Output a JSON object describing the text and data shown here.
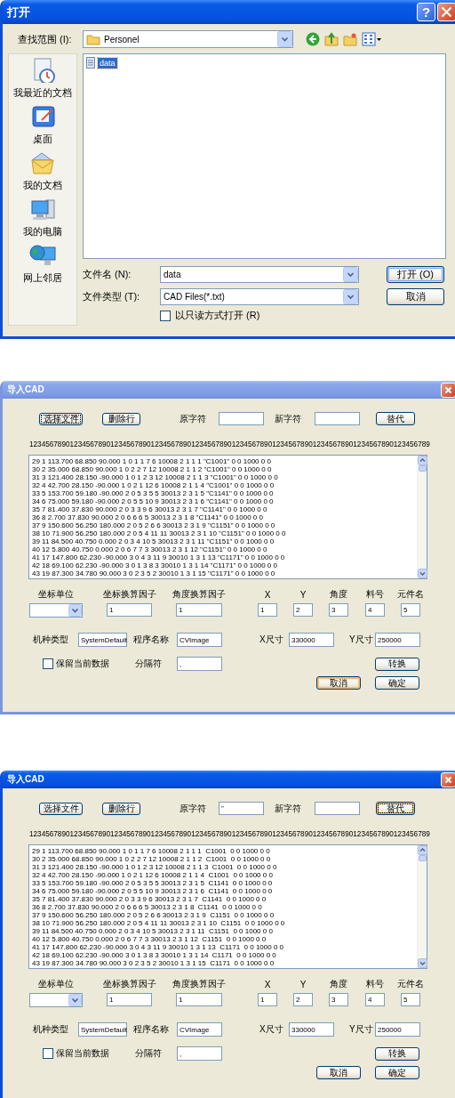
{
  "open_dialog": {
    "window": {
      "title": "打开",
      "active": true
    },
    "help_button": "?",
    "look_in": {
      "label": "查找范围 (I):",
      "value": "Personel"
    },
    "places": [
      {
        "label": "我最近的文档",
        "kind": "recent"
      },
      {
        "label": "桌面",
        "kind": "desktop"
      },
      {
        "label": "我的文档",
        "kind": "documents"
      },
      {
        "label": "我的电脑",
        "kind": "computer"
      },
      {
        "label": "网上邻居",
        "kind": "network"
      }
    ],
    "files": [
      {
        "name": "data",
        "selected": true
      }
    ],
    "file_name": {
      "label": "文件名 (N):",
      "value": "data"
    },
    "file_type": {
      "label": "文件类型 (T):",
      "value": "CAD Files(*.txt)"
    },
    "buttons": [
      {
        "label": "打开 (O)",
        "default": true
      },
      {
        "label": "取消",
        "default": false
      }
    ],
    "read_only": {
      "label": "以只读方式打开 (R)",
      "checked": false
    }
  },
  "import_dialogs": [
    {
      "window": {
        "title": "导入CAD",
        "active": false
      },
      "toolbar_buttons": [
        {
          "label": "选择文件",
          "focused": true,
          "hovered": false
        },
        {
          "label": "删除行",
          "focused": false,
          "hovered": false
        }
      ],
      "find": {
        "label": "原字符"
      },
      "replace_with": {
        "label": "新字符"
      },
      "replace_button": {
        "label": "替代",
        "focused": false,
        "hovered": false
      },
      "ruler": "123456789012345678901234567890123456789012345678901234567890123456789012345678901234567890123456789",
      "lines": [
        "29 1 113.700 68.850 90.000 1 0 1 1 7 6 10008 2 1 1 1 \"C1001\" 0 0 1000 0 0",
        "30 2 35.000 68.850 90.000 1 0 2 2 7 12 10008 2 1 1 2 \"C1001\" 0 0 1000 0 0",
        "31 3 121.400 28.150 -90.000 1 0 1 2 3 12 10008 2 1 1 3 \"C1001\" 0 0 1000 0 0",
        "32 4 42.700 28.150 -90.000 1 0 2 1 12 6 10008 2 1 1 4 \"C1001\" 0 0 1000 0 0",
        "33 5 153.700 59.180 -90.000 2 0 5 3 5 5 30013 2 3 1 5 \"C1141\" 0 0 1000 0 0",
        "34 6 75.000 59.180 -90.000 2 0 5 5 10 9 30013 2 3 1 6 \"C1141\" 0 0 1000 0 0",
        "35 7 81.400 37.830 90.000 2 0 3 3 9 6 30013 2 3 1 7 \"C1141\" 0 0 1000 0 0",
        "36 8 2.700 37.830 90.000 2 0 6 6 6 5 30013 2 3 1 8 \"C1141\" 0 0 1000 0 0",
        "37 9 150.600 56.250 180.000 2 0 5 2 6 6 30013 2 3 1 9 \"C1151\" 0 0 1000 0 0",
        "38 10 71.900 56.250 180.000 2 0 5 4 11 11 30013 2 3 1 10 \"C1151\" 0 0 1000 0 0",
        "39 11 84.500 40.750 0.000 2 0 3 4 10 5 30013 2 3 1 11 \"C1151\" 0 0 1000 0 0",
        "40 12 5.800 40.750 0.000 2 0 6 7 7 3 30013 2 3 1 12 \"C1151\" 0 0 1000 0 0",
        "41 17 147.800 62.230 -90.000 3 0 4 3 11 9 30010 1 3 1 13 \"C1171\" 0 0 1000 0 0",
        "42 18 69.100 62.230 -90.000 3 0 1 3 8 3 30010 1 3 1 14 \"C1171\" 0 0 1000 0 0",
        "43 19 87.300 34.780 90.000 3 0 2 3 5 2 30010 1 3 1 15 \"C1171\" 0 0 1000 0 0"
      ],
      "columns": [
        {
          "label": "坐标单位",
          "kind": "dropdown"
        },
        {
          "label": "坐标换算因子",
          "kind": "field",
          "value": "1"
        },
        {
          "label": "角度换算因子",
          "kind": "field",
          "value": "1"
        },
        {
          "label": "X",
          "kind": "field",
          "value": "1"
        },
        {
          "label": "Y",
          "kind": "field",
          "value": "2"
        },
        {
          "label": "角度",
          "kind": "field",
          "value": "3"
        },
        {
          "label": "料号",
          "kind": "field",
          "value": "4"
        },
        {
          "label": "元件名",
          "kind": "field",
          "value": "5"
        }
      ],
      "settings": [
        {
          "label": "机种类型",
          "value": "SystemDefault"
        },
        {
          "label": "程序名称",
          "value": "CVImage"
        },
        {
          "label": "X尺寸",
          "value": "330000"
        },
        {
          "label": "Y尺寸",
          "value": "250000"
        }
      ],
      "keep_data": {
        "label": "保留当前数据",
        "checked": false
      },
      "separator": {
        "label": "分隔符",
        "value": ","
      },
      "buttons": [
        {
          "label": "转换",
          "focused": false,
          "hovered": false
        },
        {
          "label": "取消",
          "focused": false,
          "hovered": true
        },
        {
          "label": "确定",
          "focused": false,
          "hovered": false
        }
      ]
    },
    {
      "window": {
        "title": "导入CAD",
        "active": true
      },
      "toolbar_buttons": [
        {
          "label": "选择文件",
          "focused": false,
          "hovered": false
        },
        {
          "label": "删除行",
          "focused": false,
          "hovered": false
        }
      ],
      "find": {
        "label": "原字符",
        "value": "\""
      },
      "replace_with": {
        "label": "新字符"
      },
      "replace_button": {
        "label": "替代",
        "focused": true,
        "hovered": true
      },
      "ruler": "123456789012345678901234567890123456789012345678901234567890123456789012345678901234567890123456789",
      "lines": [
        "29 1 113.700 68.850 90.000 1 0 1 1 7 6 10008 2 1 1 1  C1001  0 0 1000 0 0",
        "30 2 35.000 68.850 90.000 1 0 2 2 7 12 10008 2 1 1 2  C1001  0 0 1000 0 0",
        "31 3 121.400 28.150 -90.000 1 0 1 2 3 12 10008 2 1 1 3  C1001  0 0 1000 0 0",
        "32 4 42.700 28.150 -90.000 1 0 2 1 12 6 10008 2 1 1 4  C1001  0 0 1000 0 0",
        "33 5 153.700 59.180 -90.000 2 0 5 3 5 5 30013 2 3 1 5  C1141  0 0 1000 0 0",
        "34 6 75.000 59.180 -90.000 2 0 5 5 10 9 30013 2 3 1 6  C1141  0 0 1000 0 0",
        "35 7 81.400 37.830 90.000 2 0 3 3 9 6 30013 2 3 1 7  C1141  0 0 1000 0 0",
        "36 8 2.700 37.830 90.000 2 0 6 6 6 5 30013 2 3 1 8  C1141  0 0 1000 0 0",
        "37 9 150.600 56.250 180.000 2 0 5 2 6 6 30013 2 3 1 9  C1151  0 0 1000 0 0",
        "38 10 71.900 56.250 180.000 2 0 5 4 11 11 30013 2 3 1 10  C1151  0 0 1000 0 0",
        "39 11 84.500 40.750 0.000 2 0 3 4 10 5 30013 2 3 1 11  C1151  0 0 1000 0 0",
        "40 12 5.800 40.750 0.000 2 0 6 7 7 3 30013 2 3 1 12  C1151  0 0 1000 0 0",
        "41 17 147.800 62.230 -90.000 3 0 4 3 11 9 30010 1 3 1 13  C1171  0 0 1000 0 0",
        "42 18 69.100 62.230 -90.000 3 0 1 3 8 3 30010 1 3 1 14  C1171  0 0 1000 0 0",
        "43 19 87.300 34.780 90.000 3 0 2 3 5 2 30010 1 3 1 15  C1171  0 0 1000 0 0"
      ],
      "columns": [
        {
          "label": "坐标单位",
          "kind": "dropdown"
        },
        {
          "label": "坐标换算因子",
          "kind": "field",
          "value": "1"
        },
        {
          "label": "角度换算因子",
          "kind": "field",
          "value": "1"
        },
        {
          "label": "X",
          "kind": "field",
          "value": "1"
        },
        {
          "label": "Y",
          "kind": "field",
          "value": "2"
        },
        {
          "label": "角度",
          "kind": "field",
          "value": "3"
        },
        {
          "label": "料号",
          "kind": "field",
          "value": "4"
        },
        {
          "label": "元件名",
          "kind": "field",
          "value": "5"
        }
      ],
      "settings": [
        {
          "label": "机种类型",
          "value": "SystemDefault"
        },
        {
          "label": "程序名称",
          "value": "CVImage"
        },
        {
          "label": "X尺寸",
          "value": "330000"
        },
        {
          "label": "Y尺寸",
          "value": "250000"
        }
      ],
      "keep_data": {
        "label": "保留当前数据",
        "checked": false
      },
      "separator": {
        "label": "分隔符",
        "value": ","
      },
      "buttons": [
        {
          "label": "转换",
          "focused": false,
          "hovered": false
        },
        {
          "label": "取消",
          "focused": false,
          "hovered": false
        },
        {
          "label": "确定",
          "focused": false,
          "hovered": false
        }
      ]
    }
  ]
}
